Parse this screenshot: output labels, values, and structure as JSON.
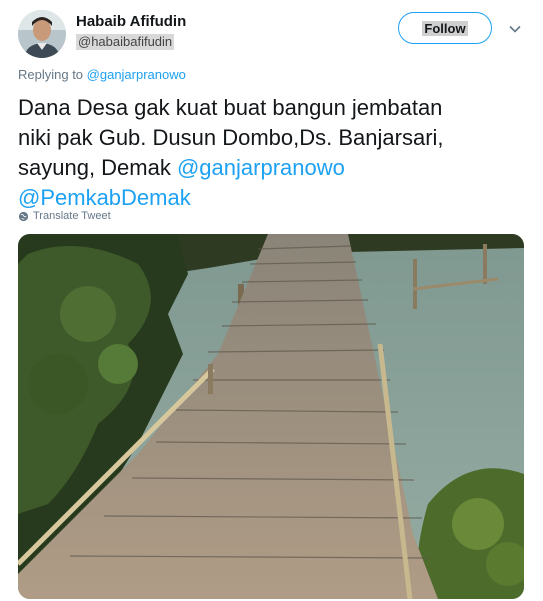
{
  "author": {
    "display_name": "Habaib Afifudin",
    "handle": "@habaibafifudin"
  },
  "follow_button": {
    "label": "Follow"
  },
  "reply": {
    "prefix": "Replying to ",
    "mention": "@ganjarpranowo"
  },
  "tweet": {
    "text_line1": "Dana Desa gak kuat buat bangun jembatan",
    "text_line2": "niki pak Gub. Dusun Dombo,Ds. Banjarsari,",
    "text_line3_prefix": "sayung, Demak ",
    "mention1": "@ganjarpranowo",
    "mention2": "@PemkabDemak"
  },
  "translate": {
    "label": "Translate Tweet"
  },
  "icons": {
    "caret": "chevron-down-icon",
    "globe": "globe-icon"
  },
  "colors": {
    "accent": "#1da1f2",
    "text": "#14171a",
    "muted": "#657786"
  }
}
